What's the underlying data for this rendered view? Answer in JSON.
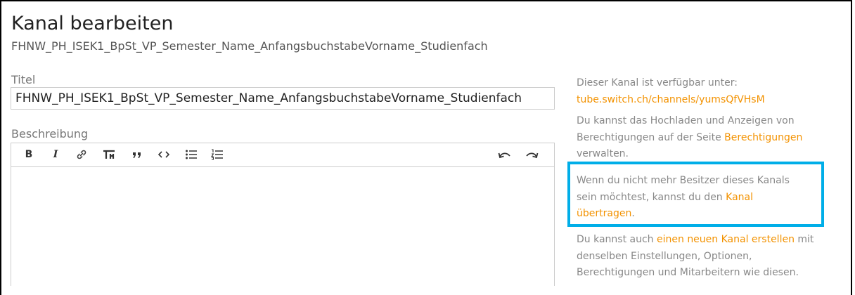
{
  "header": {
    "title": "Kanal bearbeiten",
    "subtitle": "FHNW_PH_ISEK1_BpSt_VP_Semester_Name_AnfangsbuchstabeVorname_Studienfach"
  },
  "form": {
    "title_label": "Titel",
    "title_value": "FHNW_PH_ISEK1_BpSt_VP_Semester_Name_AnfangsbuchstabeVorname_Studienfach",
    "description_label": "Beschreibung",
    "toolbar": {
      "bold": "B",
      "italic": "I",
      "link": "link-icon",
      "heading": "heading-icon",
      "quote": "quote-icon",
      "code": "code-icon",
      "bullet_list": "bullet-list-icon",
      "ordered_list": "ordered-list-icon",
      "undo": "undo-icon",
      "redo": "redo-icon"
    }
  },
  "sidebar": {
    "availability_text": "Dieser Kanal ist verfügbar unter:",
    "channel_url": "tube.switch.ch/channels/yumsQfVHsM",
    "permissions_text_1": "Du kannst das Hochladen und Anzeigen von",
    "permissions_text_2": "Berechtigungen auf der Seite",
    "permissions_link": "Berechtigungen",
    "permissions_text_3": "verwalten.",
    "transfer_text_1": "Wenn du nicht mehr Besitzer dieses Kanals",
    "transfer_text_2": "sein möchtest, kannst du den",
    "transfer_link_1": "Kanal",
    "transfer_link_2": "übertragen",
    "transfer_text_3": ".",
    "new_channel_text_1": "Du kannst auch",
    "new_channel_link": "einen neuen Kanal erstellen",
    "new_channel_text_2": "mit",
    "new_channel_text_3": "denselben Einstellungen, Optionen,",
    "new_channel_text_4": "Berechtigungen und Mitarbeitern wie diesen."
  },
  "colors": {
    "accent_link": "#f39200",
    "highlight_box": "#00aee8"
  }
}
